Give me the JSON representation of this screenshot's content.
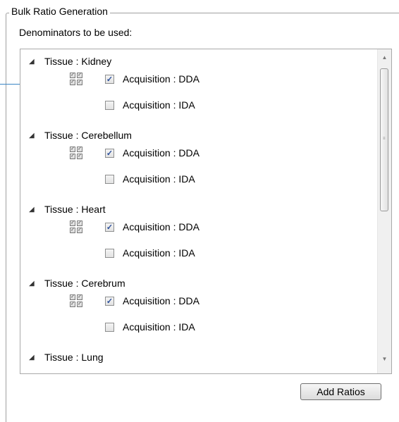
{
  "group": {
    "title": "Bulk Ratio Generation"
  },
  "denominators_label": "Denominators to be used:",
  "tree": {
    "tissues": [
      {
        "label": "Tissue : Kidney",
        "acquisitions": [
          {
            "label": "Acquisition : DDA",
            "checked": true
          },
          {
            "label": "Acquisition : IDA",
            "checked": false
          }
        ]
      },
      {
        "label": "Tissue : Cerebellum",
        "acquisitions": [
          {
            "label": "Acquisition : DDA",
            "checked": true
          },
          {
            "label": "Acquisition : IDA",
            "checked": false
          }
        ]
      },
      {
        "label": "Tissue : Heart",
        "acquisitions": [
          {
            "label": "Acquisition : DDA",
            "checked": true
          },
          {
            "label": "Acquisition : IDA",
            "checked": false
          }
        ]
      },
      {
        "label": "Tissue : Cerebrum",
        "acquisitions": [
          {
            "label": "Acquisition : DDA",
            "checked": true
          },
          {
            "label": "Acquisition : IDA",
            "checked": false
          }
        ]
      },
      {
        "label": "Tissue : Lung",
        "acquisitions": []
      }
    ]
  },
  "buttons": {
    "add_ratios": "Add Ratios"
  },
  "colors": {
    "callout_line": "#3a86c4",
    "check_mark": "#2a4e9a"
  }
}
